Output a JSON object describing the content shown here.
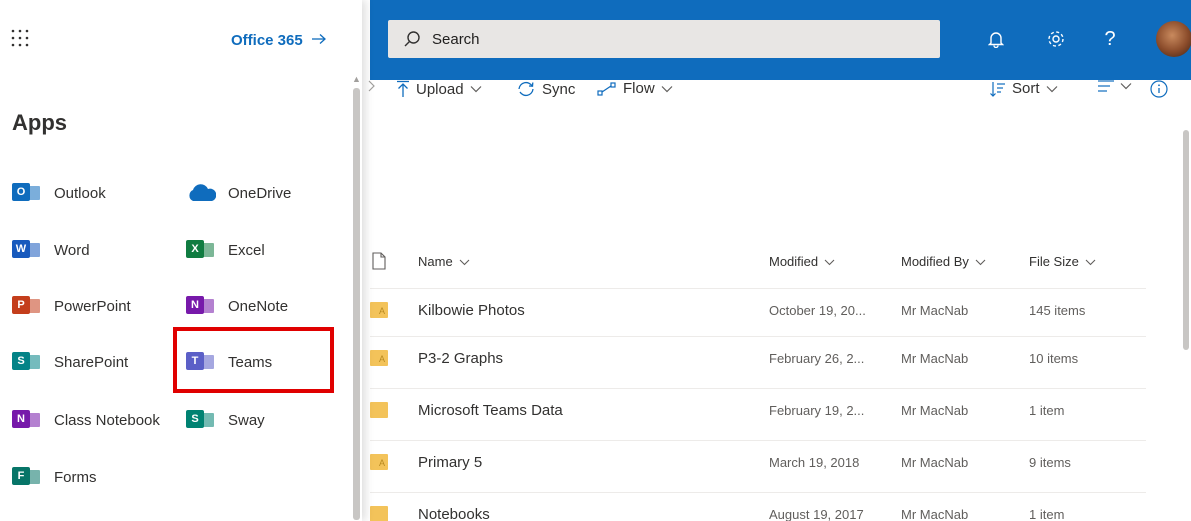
{
  "launcher": {
    "office365_label": "Office 365",
    "apps_heading": "Apps",
    "apps": [
      {
        "label": "Outlook",
        "icon": "outlook-icon",
        "color": "#0f6cbd",
        "letter": "O"
      },
      {
        "label": "OneDrive",
        "icon": "onedrive-icon",
        "color": "#0f6cbd"
      },
      {
        "label": "Word",
        "icon": "word-icon",
        "color": "#185abd",
        "letter": "W"
      },
      {
        "label": "Excel",
        "icon": "excel-icon",
        "color": "#107c41",
        "letter": "X"
      },
      {
        "label": "PowerPoint",
        "icon": "powerpoint-icon",
        "color": "#c43e1c",
        "letter": "P"
      },
      {
        "label": "OneNote",
        "icon": "onenote-icon",
        "color": "#7719aa",
        "letter": "N"
      },
      {
        "label": "SharePoint",
        "icon": "sharepoint-icon",
        "color": "#038387",
        "letter": "S"
      },
      {
        "label": "Teams",
        "icon": "teams-icon",
        "color": "#5b5fc7",
        "letter": "T"
      },
      {
        "label": "Class Notebook",
        "icon": "class-notebook-icon",
        "color": "#7719aa",
        "letter": "N"
      },
      {
        "label": "Sway",
        "icon": "sway-icon",
        "color": "#008272",
        "letter": "S"
      },
      {
        "label": "Forms",
        "icon": "forms-icon",
        "color": "#077568",
        "letter": "F"
      }
    ]
  },
  "header": {
    "search_placeholder": "Search",
    "help_glyph": "?"
  },
  "commands": {
    "upload": "Upload",
    "sync": "Sync",
    "flow": "Flow",
    "sort": "Sort"
  },
  "list": {
    "columns": {
      "name": "Name",
      "modified": "Modified",
      "modified_by": "Modified By",
      "file_size": "File Size"
    },
    "rows": [
      {
        "name": "Kilbowie Photos",
        "modified": "October 19, 20...",
        "modified_by": "Mr MacNab",
        "file_size": "145 items",
        "shared": true
      },
      {
        "name": "P3-2 Graphs",
        "modified": "February 26, 2...",
        "modified_by": "Mr MacNab",
        "file_size": "10 items",
        "shared": true
      },
      {
        "name": "Microsoft Teams Data",
        "modified": "February 19, 2...",
        "modified_by": "Mr MacNab",
        "file_size": "1 item",
        "shared": false
      },
      {
        "name": "Primary 5",
        "modified": "March 19, 2018",
        "modified_by": "Mr MacNab",
        "file_size": "9 items",
        "shared": true
      },
      {
        "name": "Notebooks",
        "modified": "August 19, 2017",
        "modified_by": "Mr MacNab",
        "file_size": "1 item",
        "shared": false
      }
    ]
  },
  "colors": {
    "suite_bar": "#0f6cbd",
    "highlight_box": "#e00000"
  }
}
